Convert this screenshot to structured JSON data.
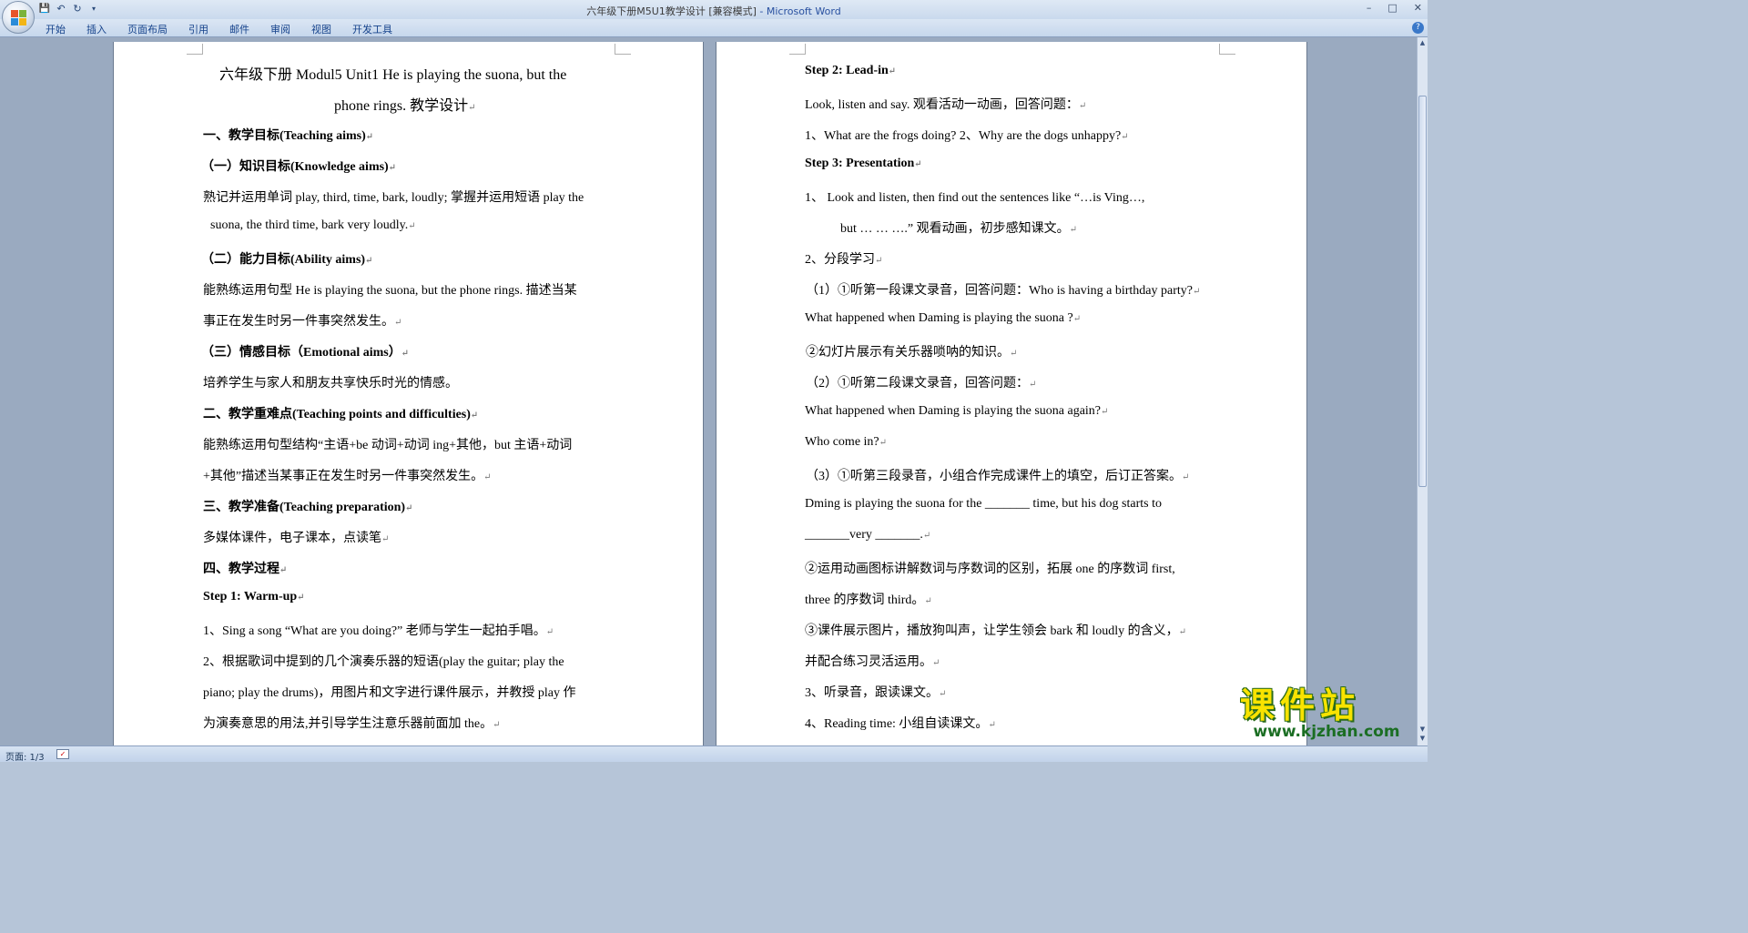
{
  "window": {
    "title": "六年级下册M5U1教学设计 [兼容模式]",
    "app_suffix": " - Microsoft Word",
    "controls": [
      "–",
      "□",
      "✕"
    ]
  },
  "qat": {
    "save": "💾",
    "undo": "↶",
    "redo": "↻",
    "more": "▾"
  },
  "ribbon": {
    "tabs": [
      "开始",
      "插入",
      "页面布局",
      "引用",
      "邮件",
      "审阅",
      "视图",
      "开发工具"
    ],
    "help": "?"
  },
  "page1": {
    "title1": "六年级下册 Modul5 Unit1 He is playing the suona, but the",
    "title2": "phone rings.  教学设计",
    "lines": [
      "一、教学目标(Teaching aims)",
      "（一）知识目标(Knowledge aims)",
      "熟记并运用单词 play, third, time, bark, loudly; 掌握并运用短语 play the",
      "suona, the third time, bark very loudly.",
      "（二）能力目标(Ability aims)",
      "能熟练运用句型 He is playing the suona, but the phone rings.  描述当某",
      "事正在发生时另一件事突然发生。",
      "（三）情感目标（Emotional aims）",
      "培养学生与家人和朋友共享快乐时光的情感。",
      "二、教学重难点(Teaching points and difficulties)",
      "能熟练运用句型结构“主语+be 动词+动词 ing+其他，but  主语+动词",
      "+其他”描述当某事正在发生时另一件事突然发生。",
      "三、教学准备(Teaching preparation)",
      "多媒体课件，电子课本，点读笔",
      "四、教学过程",
      "Step 1: Warm-up",
      "1、Sing a song “What are you doing?” 老师与学生一起拍手唱。",
      "2、根据歌词中提到的几个演奏乐器的短语(play the guitar; play the",
      "piano; play the drums)，用图片和文字进行课件展示，并教授 play 作",
      "为演奏意思的用法,并引导学生注意乐器前面加 the。"
    ]
  },
  "page2": {
    "lines": [
      "Step 2: Lead-in",
      "Look, listen and say. 观看活动一动画，回答问题：",
      "1、What are the frogs doing?      2、Why are the dogs unhappy?",
      "Step 3: Presentation",
      "1、     Look and listen, then find out the sentences like “…is Ving…,",
      "but … … ….” 观看动画，初步感知课文。",
      "2、分段学习",
      "（1）①听第一段课文录音，回答问题：Who is having a birthday party?",
      "What happened when Daming is playing the suona ?",
      " ②幻灯片展示有关乐器唢呐的知识。",
      "（2）①听第二段课文录音，回答问题：",
      "What happened when Daming is playing the suona again?",
      "Who come in?",
      "（3）①听第三段录音，小组合作完成课件上的填空，后订正答案。",
      "Dming is playing the suona for the _______ time, but his dog starts to",
      "_______very _______.",
      "②运用动画图标讲解数词与序数词的区别，拓展 one 的序数词 first,",
      "three 的序数词 third。",
      "③课件展示图片，播放狗叫声，让学生领会 bark 和 loudly 的含义，",
      "并配合练习灵活运用。",
      "3、听录音，跟读课文。",
      "4、Reading time: 小组自读课文。"
    ]
  },
  "paragraph_mark": "↵",
  "status": {
    "page": "页面: 1/3"
  },
  "watermark": {
    "cn": "课件站",
    "url": "www.kjzhan.com"
  },
  "colors": {
    "accent": "#2850a0",
    "workspace": "#9aaac0",
    "ribbon": "#c6d7ec",
    "watermark_yellow": "#f8e300",
    "watermark_green": "#1b6e23"
  },
  "icons": [
    "office-orb-icon",
    "save-icon",
    "undo-icon",
    "redo-icon",
    "help-icon",
    "scroll-up-icon",
    "scroll-down-icon",
    "spellcheck-icon"
  ]
}
